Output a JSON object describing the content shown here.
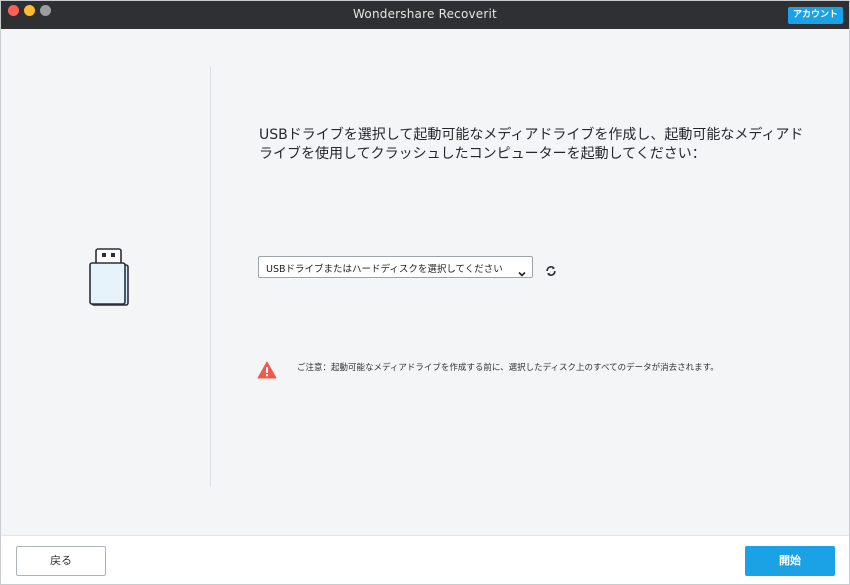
{
  "titlebar": {
    "title": "Wondershare Recoverit",
    "account_label": "アカウント"
  },
  "main": {
    "instruction": "USBドライブを選択して起動可能なメディアドライブを作成し、起動可能なメディアドライブを使用してクラッシュしたコンピューターを起動してください：",
    "drive_select": {
      "selected": "USBドライブまたはハードディスクを選択してください"
    },
    "warning": "ご注意：起動可能なメディアドライブを作成する前に、選択したディスク上のすべてのデータが消去されます。"
  },
  "footer": {
    "back_label": "戻る",
    "start_label": "開始"
  },
  "colors": {
    "accent": "#1ba2e6",
    "warning": "#f05a4a",
    "titlebar": "#2f3033"
  },
  "icons": [
    "usb-drive-icon",
    "refresh-icon",
    "warning-icon",
    "chevron-down-icon"
  ]
}
